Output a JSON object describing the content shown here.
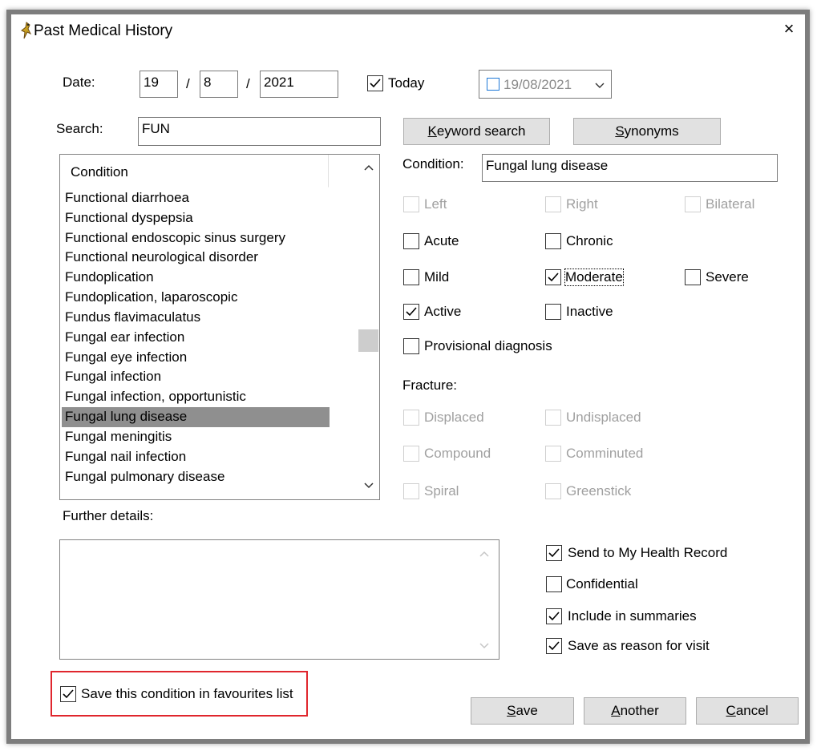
{
  "window": {
    "title": "Past Medical History",
    "close_glyph": "×"
  },
  "date": {
    "label": "Date:",
    "day": "19",
    "month": "8",
    "year": "2021",
    "sep": "/",
    "today_label": "Today",
    "today_checked": true,
    "picker_value": "19/08/2021"
  },
  "search": {
    "label": "Search:",
    "value": "FUN"
  },
  "buttons": {
    "keyword": "Keyword search",
    "synonyms": "Synonyms",
    "save": "Save",
    "another": "Another",
    "cancel": "Cancel"
  },
  "list": {
    "header": "Condition",
    "items": [
      "Functional diarrhoea",
      "Functional dyspepsia",
      "Functional endoscopic sinus surgery",
      "Functional neurological disorder",
      "Fundoplication",
      "Fundoplication, laparoscopic",
      "Fundus flavimaculatus",
      "Fungal ear infection",
      "Fungal eye infection",
      "Fungal infection",
      "Fungal infection, opportunistic",
      "Fungal lung disease",
      "Fungal meningitis",
      "Fungal nail infection",
      "Fungal pulmonary disease"
    ],
    "selected": "Fungal lung disease"
  },
  "condition": {
    "label": "Condition:",
    "value": "Fungal lung disease"
  },
  "options": {
    "left": {
      "label": "Left",
      "checked": false,
      "enabled": false
    },
    "right": {
      "label": "Right",
      "checked": false,
      "enabled": false
    },
    "bilateral": {
      "label": "Bilateral",
      "checked": false,
      "enabled": false
    },
    "acute": {
      "label": "Acute",
      "checked": false,
      "enabled": true
    },
    "chronic": {
      "label": "Chronic",
      "checked": false,
      "enabled": true
    },
    "mild": {
      "label": "Mild",
      "checked": false,
      "enabled": true
    },
    "moderate": {
      "label": "Moderate",
      "checked": true,
      "enabled": true
    },
    "severe": {
      "label": "Severe",
      "checked": false,
      "enabled": true
    },
    "active": {
      "label": "Active",
      "checked": true,
      "enabled": true
    },
    "inactive": {
      "label": "Inactive",
      "checked": false,
      "enabled": true
    },
    "provisional": {
      "label": "Provisional diagnosis",
      "checked": false,
      "enabled": true
    }
  },
  "fracture": {
    "label": "Fracture:",
    "displaced": "Displaced",
    "undisplaced": "Undisplaced",
    "compound": "Compound",
    "comminuted": "Comminuted",
    "spiral": "Spiral",
    "greenstick": "Greenstick"
  },
  "further": {
    "label": "Further details:",
    "value": ""
  },
  "flags": {
    "send_mhr": {
      "label": "Send to My Health Record",
      "checked": true
    },
    "confidential": {
      "label": "Confidential",
      "checked": false
    },
    "include_summaries": {
      "label": "Include in summaries",
      "checked": true
    },
    "save_reason": {
      "label": "Save as reason for visit",
      "checked": true
    }
  },
  "favourites": {
    "label": "Save this condition in favourites list",
    "checked": true
  },
  "colors": {
    "highlight": "#e0262d",
    "selected_row": "#8f8f8f",
    "button_bg": "#e1e1e1"
  }
}
